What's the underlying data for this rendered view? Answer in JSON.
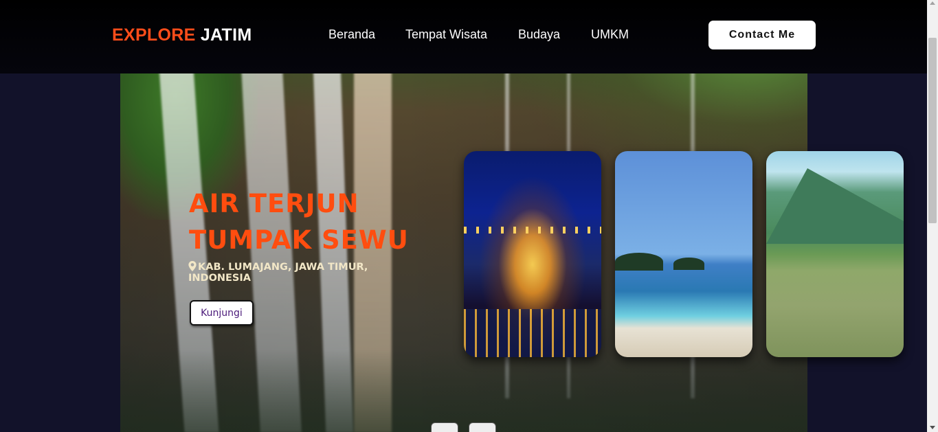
{
  "header": {
    "logo_part1": "EXPLORE",
    "logo_part2": "JATIM",
    "nav": [
      {
        "label": "Beranda"
      },
      {
        "label": "Tempat Wisata"
      },
      {
        "label": "Budaya"
      },
      {
        "label": "UMKM"
      }
    ],
    "contact_label": "Contact Me"
  },
  "hero": {
    "title": "AIR TERJUN TUMPAK SEWU",
    "location": "KAB. LUMAJANG, JAWA TIMUR, INDONESIA",
    "button_label": "Kunjungi"
  },
  "cards": [
    {
      "icon": "night-bridge-image"
    },
    {
      "icon": "beach-image"
    },
    {
      "icon": "savanna-image"
    }
  ],
  "colors": {
    "accent": "#ff4d0f",
    "header_bg": "#000000",
    "page_bg": "#12122a"
  }
}
